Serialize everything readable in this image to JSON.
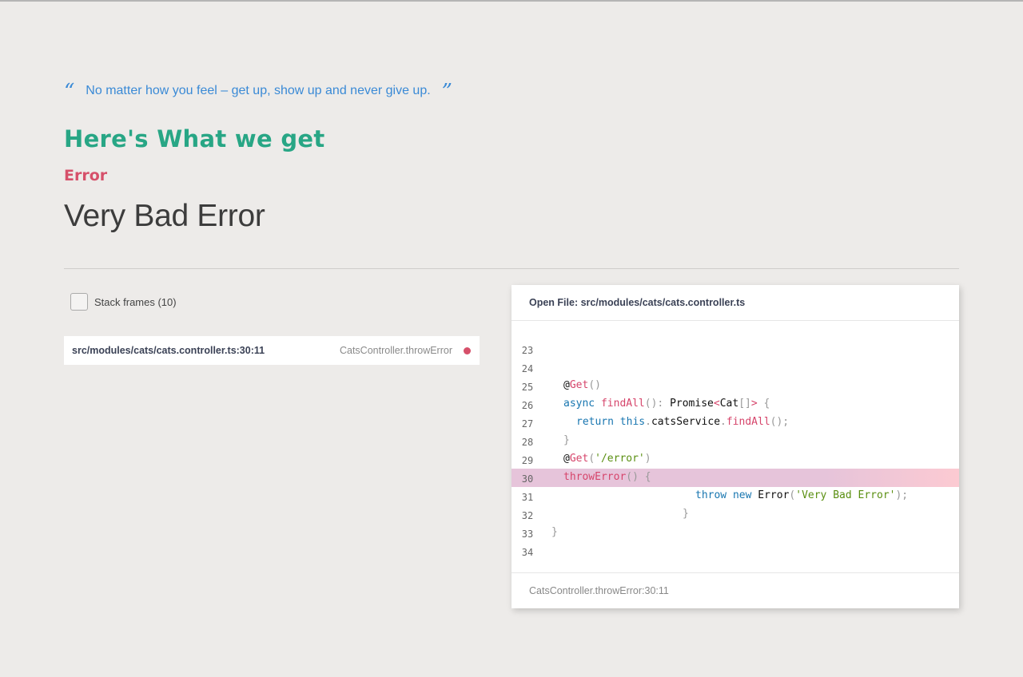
{
  "quote": {
    "open_mark": "“",
    "text": "No matter how you feel – get up, show up and never give up.",
    "close_mark": "”"
  },
  "heading": "Here's What we get",
  "error": {
    "type": "Error",
    "message": "Very Bad Error"
  },
  "frames": {
    "toggle_label": "Stack frames (10)",
    "items": [
      {
        "file": "src/modules/cats/cats.controller.ts:30:11",
        "method": "CatsController.throwError"
      }
    ]
  },
  "code_panel": {
    "title": "Open File: src/modules/cats/cats.controller.ts",
    "footer": "CatsController.throwError:30:11",
    "highlight_line": "30",
    "lines": [
      {
        "num": "23"
      },
      {
        "num": "24"
      },
      {
        "num": "25"
      },
      {
        "num": "26"
      },
      {
        "num": "27"
      },
      {
        "num": "28"
      },
      {
        "num": "29"
      },
      {
        "num": "30"
      },
      {
        "num": "31"
      },
      {
        "num": "32"
      },
      {
        "num": "33"
      },
      {
        "num": "34"
      }
    ],
    "tokens": {
      "l25": {
        "at": "@",
        "fn": "Get",
        "p": "()"
      },
      "l26": {
        "kw": "async",
        "fn": "findAll",
        "p1": "():",
        "type1": "Promise",
        "lt": "<",
        "type2": "Cat",
        "br": "[]",
        "gt": ">",
        "ob": "{"
      },
      "l27": {
        "kw1": "return",
        "kw2": "this",
        "dot1": ".",
        "obj": "catsService",
        "dot2": ".",
        "fn": "findAll",
        "p": "();"
      },
      "l28": {
        "cb": "}"
      },
      "l29": {
        "at": "@",
        "fn": "Get",
        "p1": "(",
        "str": "'/error'",
        "p2": ")"
      },
      "l30": {
        "fn": "throwError",
        "p": "()",
        "ob": "{"
      },
      "l31": {
        "kw1": "throw",
        "kw2": "new",
        "cls": "Error",
        "p1": "(",
        "str": "'Very Bad Error'",
        "p2": ");"
      },
      "l32": {
        "cb": "}"
      },
      "l33": {
        "cb": "}"
      }
    }
  },
  "colors": {
    "background": "#edebe9",
    "quote": "#3a8ad6",
    "heading": "#28a685",
    "error_type": "#d6506a",
    "highlight": "#e6c4da"
  }
}
